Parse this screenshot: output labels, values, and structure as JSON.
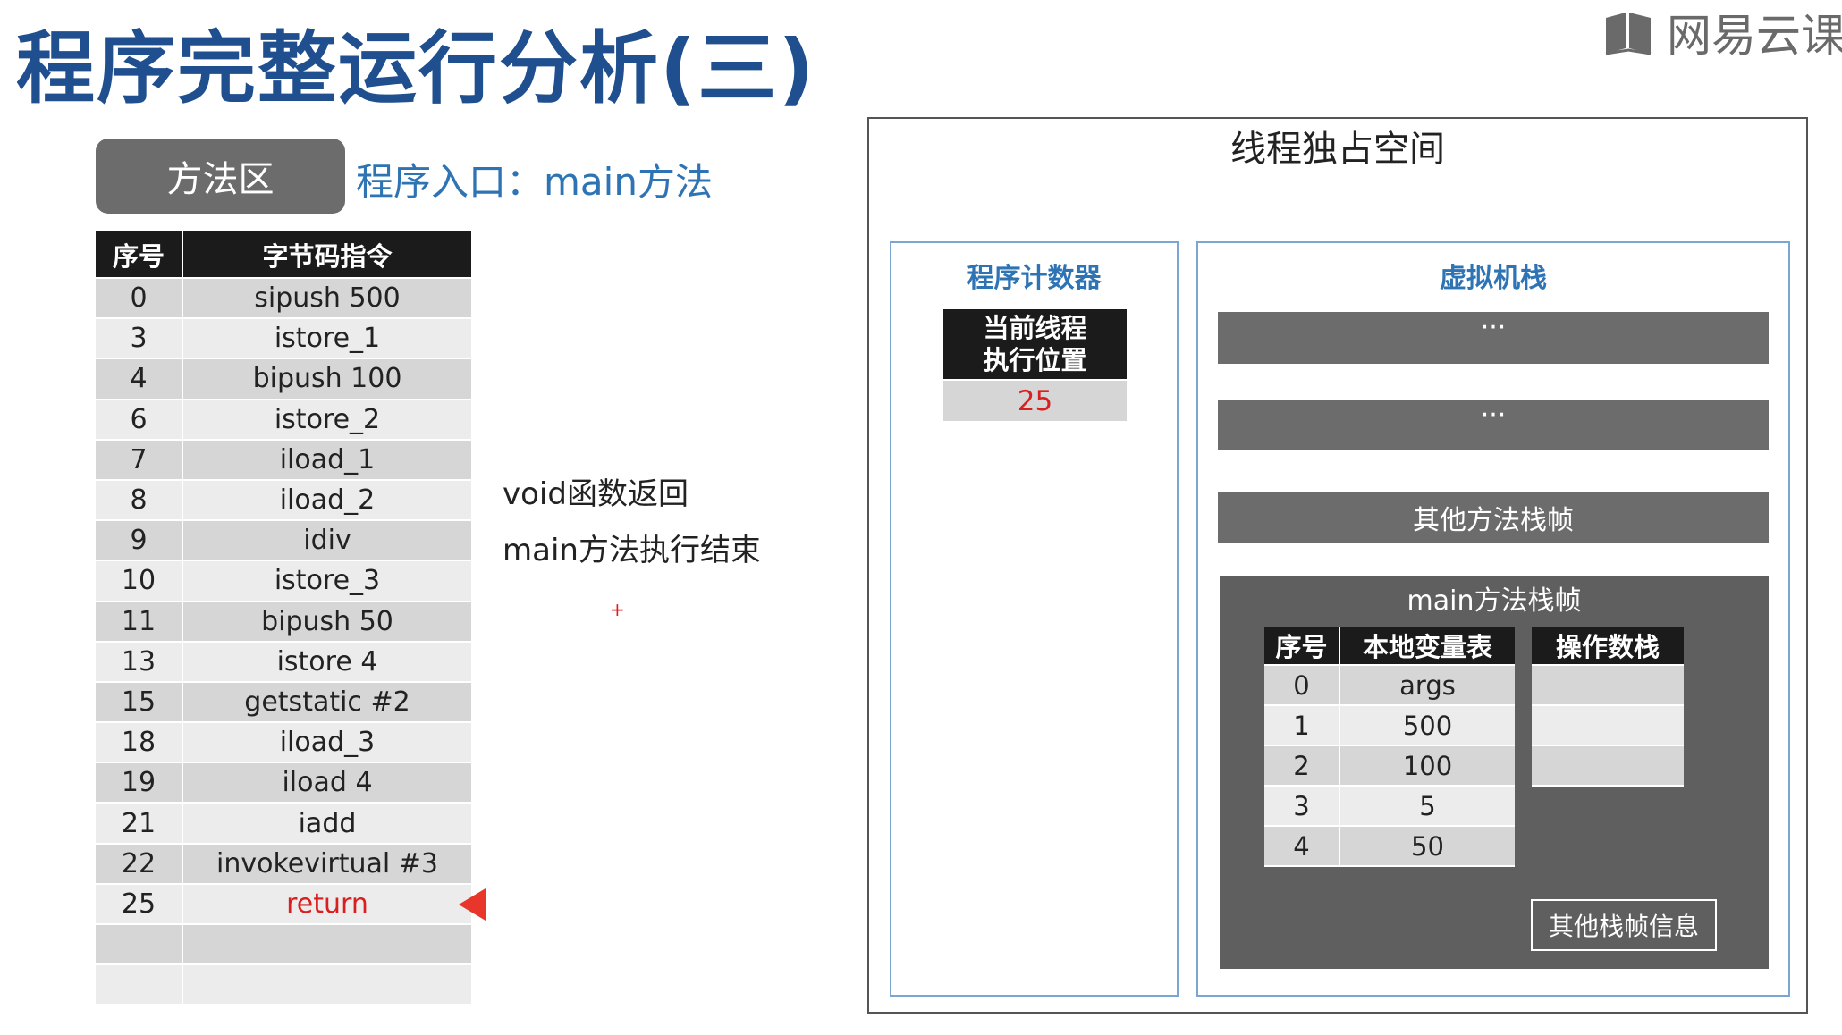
{
  "title": "程序完整运行分析(三)",
  "logo": {
    "text": "网易云课",
    "icon": "book-icon"
  },
  "method_area": {
    "badge": "方法区",
    "entry": "程序入口：main方法"
  },
  "bytecode_table": {
    "headers": [
      "序号",
      "字节码指令"
    ],
    "rows": [
      [
        "0",
        "sipush 500"
      ],
      [
        "3",
        "istore_1"
      ],
      [
        "4",
        "bipush 100"
      ],
      [
        "6",
        "istore_2"
      ],
      [
        "7",
        "iload_1"
      ],
      [
        "8",
        "iload_2"
      ],
      [
        "9",
        "idiv"
      ],
      [
        "10",
        "istore_3"
      ],
      [
        "11",
        "bipush 50"
      ],
      [
        "13",
        "istore 4"
      ],
      [
        "15",
        "getstatic #2"
      ],
      [
        "18",
        "iload_3"
      ],
      [
        "19",
        "iload 4"
      ],
      [
        "21",
        "iadd"
      ],
      [
        "22",
        "invokevirtual #3"
      ],
      [
        "25",
        "return"
      ],
      [
        "",
        ""
      ],
      [
        "",
        ""
      ]
    ],
    "highlight_color": "#d92020",
    "pointer_icon": "triangle-pointer-icon"
  },
  "notes": {
    "line1": "void函数返回",
    "line2": "main方法执行结束",
    "mark": "+"
  },
  "thread_space": {
    "title": "线程独占空间",
    "pc_register": {
      "title": "程序计数器",
      "head_line1": "当前线程",
      "head_line2": "执行位置",
      "value": "25"
    },
    "vm_stack": {
      "title": "虚拟机栈",
      "frames": [
        "···",
        "···",
        "其他方法栈帧"
      ],
      "main_frame": {
        "title": "main方法栈帧",
        "local_vars": {
          "headers": [
            "序号",
            "本地变量表"
          ],
          "rows": [
            [
              "0",
              "args"
            ],
            [
              "1",
              "500"
            ],
            [
              "2",
              "100"
            ],
            [
              "3",
              "5"
            ],
            [
              "4",
              "50"
            ]
          ]
        },
        "operand_stack": {
          "header": "操作数栈",
          "rows": [
            "",
            "",
            ""
          ]
        },
        "other_info": "其他栈帧信息"
      }
    }
  },
  "colors": {
    "title_blue": "#1f4f8f",
    "accent_blue": "#2e74b5",
    "dark_gray": "#6c6c6c",
    "header_black": "#1b1b1b",
    "red": "#d92020"
  }
}
